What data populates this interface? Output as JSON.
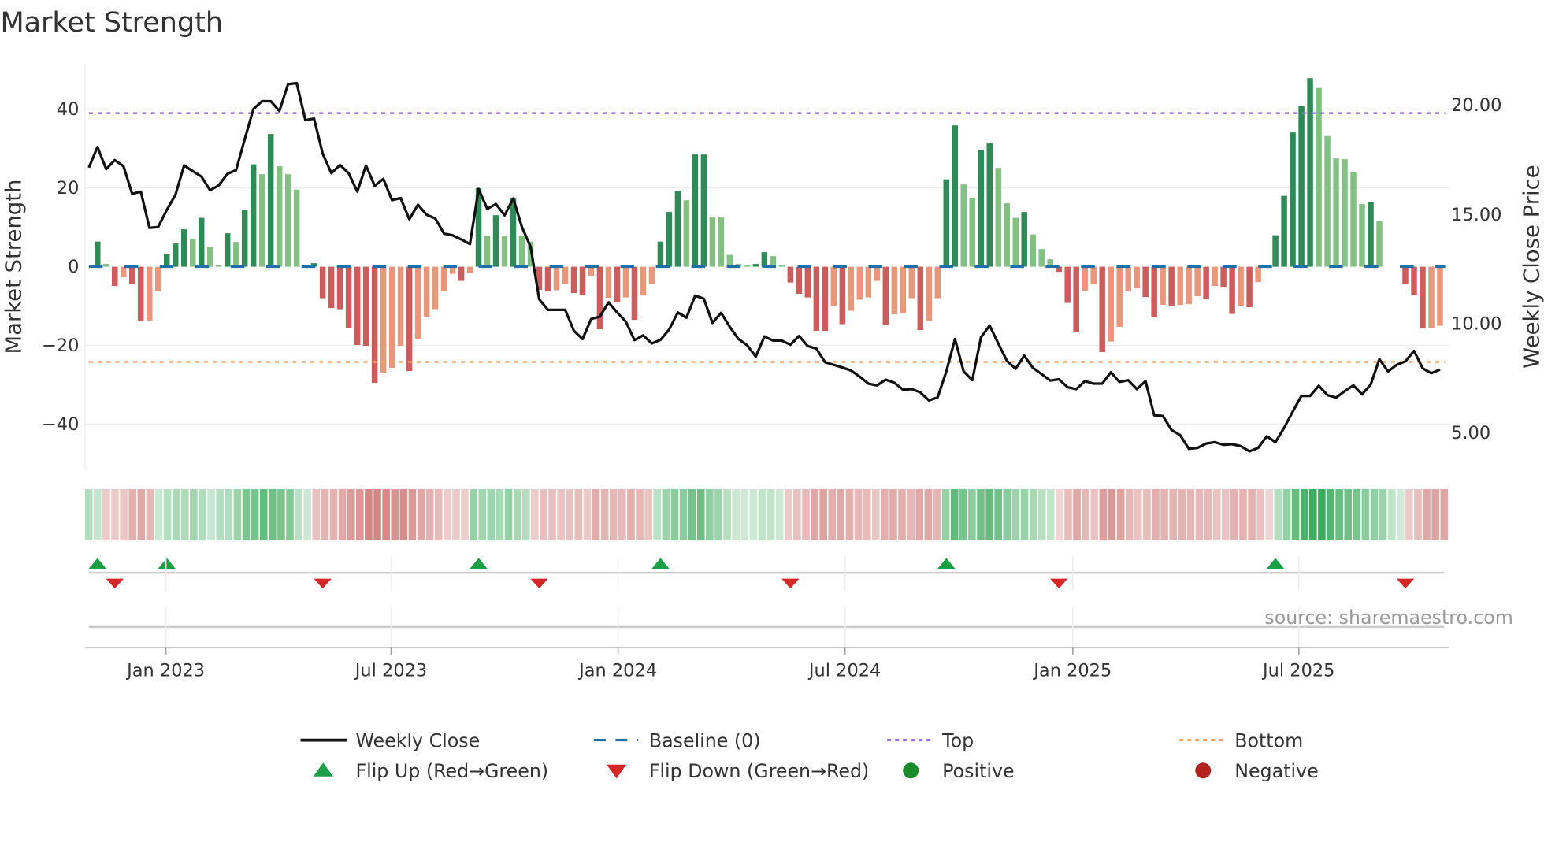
{
  "title": "Market Strength",
  "source": "source: sharemaestro.com",
  "chart_data": {
    "type": "bar+line",
    "title": "Market Strength",
    "ylabel": "Market Strength",
    "y2label": "Weekly Close Price",
    "ylim": [
      -51.75,
      51.5
    ],
    "y2lim": [
      3.4,
      21.9
    ],
    "grid": true,
    "legend_placement": "bottom-center",
    "yticks": [
      {
        "value": 40,
        "label": "40"
      },
      {
        "value": 20,
        "label": "20"
      },
      {
        "value": 0,
        "label": "0"
      },
      {
        "value": -20,
        "label": "−20"
      },
      {
        "value": -40,
        "label": "−40"
      }
    ],
    "y2ticks": [
      {
        "value": 20,
        "label": "20.00"
      },
      {
        "value": 15,
        "label": "15.00"
      },
      {
        "value": 10,
        "label": "10.00"
      },
      {
        "value": 5,
        "label": "5.00"
      }
    ],
    "xticks": [
      {
        "week": 7.9,
        "label": "Jan 2023"
      },
      {
        "week": 33.9,
        "label": "Jul 2023"
      },
      {
        "week": 60.1,
        "label": "Jan 2024"
      },
      {
        "week": 86.3,
        "label": "Jul 2024"
      },
      {
        "week": 112.6,
        "label": "Jan 2025"
      },
      {
        "week": 138.7,
        "label": "Jul 2025"
      }
    ],
    "top_level": 39,
    "bottom_level": -24.2,
    "baseline": 0,
    "strength": [
      6.4,
      0.7,
      -4.9,
      -2.7,
      -4.3,
      -13.8,
      -13.7,
      -6.3,
      3.2,
      5.9,
      9.5,
      7.0,
      12.4,
      5.0,
      0.4,
      8.5,
      6.3,
      14.4,
      26,
      23.5,
      33.7,
      25.5,
      23.5,
      19.6,
      0,
      0.9,
      -8,
      -10.5,
      -10.8,
      -15.5,
      -19.9,
      -20.1,
      -29.5,
      -26.9,
      -25.7,
      -20.1,
      -26.5,
      -18.3,
      -12.7,
      -10.8,
      -6.3,
      -1.8,
      -3.6,
      -1.6,
      19.9,
      7.9,
      13.1,
      7.9,
      17.3,
      7.9,
      6.4,
      -5.9,
      -6.3,
      -6.0,
      -4.3,
      -6.7,
      -7.3,
      -2.3,
      -15.9,
      -7.9,
      -9.0,
      -7.8,
      -13.5,
      -7.3,
      -4.3,
      6.4,
      13.9,
      19.2,
      16.9,
      28.5,
      28.5,
      12.7,
      12.5,
      3.0,
      0.7,
      0.3,
      0.7,
      3.7,
      2.7,
      0.5,
      -4.0,
      -6.9,
      -7.8,
      -16.3,
      -16.3,
      -10.0,
      -14.6,
      -11.2,
      -8.4,
      -7.8,
      -3.6,
      -14.8,
      -12.1,
      -11.8,
      -8.0,
      -16.1,
      -13.7,
      -8.0,
      22.2,
      35.9,
      20.9,
      17.5,
      29.7,
      31.4,
      25.1,
      16.1,
      12.4,
      13.9,
      8.2,
      4.5,
      1.9,
      -1.3,
      -9.2,
      -16.7,
      -6.1,
      -4.5,
      -21.7,
      -19.0,
      -15.3,
      -6.3,
      -5.5,
      -7.7,
      -12.9,
      -9.7,
      -10.0,
      -9.7,
      -9.5,
      -7.5,
      -8.3,
      -4.9,
      -5.3,
      -12.0,
      -9.9,
      -10.3,
      -3.9,
      -0.1,
      8.0,
      18.0,
      34.1,
      40.9,
      47.9,
      45.4,
      33.2,
      27.5,
      27.3,
      24.0,
      15.9,
      16.4,
      11.6,
      0,
      0,
      -4.3,
      -7.1,
      -15.7,
      -15.5,
      -15.0
    ],
    "weekly_close": [
      17.15,
      18.09,
      17.08,
      17.49,
      17.21,
      15.95,
      16.05,
      14.39,
      14.43,
      15.21,
      15.9,
      17.25,
      16.98,
      16.74,
      16.11,
      16.34,
      16.86,
      17.03,
      18.45,
      19.83,
      20.19,
      20.19,
      19.74,
      20.97,
      21.02,
      19.32,
      19.39,
      17.79,
      16.89,
      17.27,
      16.89,
      16.05,
      17.25,
      16.31,
      16.63,
      15.66,
      15.75,
      14.79,
      15.45,
      14.99,
      14.82,
      14.13,
      14.05,
      13.86,
      13.65,
      16.17,
      15.26,
      15.48,
      14.97,
      15.74,
      14.43,
      13.53,
      11.12,
      10.64,
      10.64,
      10.64,
      9.68,
      9.3,
      10.22,
      10.33,
      10.98,
      10.52,
      10.1,
      9.25,
      9.47,
      9.1,
      9.26,
      9.74,
      10.52,
      10.28,
      11.29,
      11.15,
      10.04,
      10.5,
      9.86,
      9.3,
      9.02,
      8.5,
      9.42,
      9.23,
      9.23,
      9.04,
      9.44,
      8.98,
      8.86,
      8.24,
      8.12,
      8.0,
      7.86,
      7.58,
      7.26,
      7.18,
      7.44,
      7.3,
      6.98,
      7.01,
      6.86,
      6.49,
      6.63,
      7.82,
      9.3,
      7.82,
      7.42,
      9.38,
      9.92,
      9.1,
      8.3,
      7.94,
      8.54,
      7.98,
      7.7,
      7.4,
      7.46,
      7.1,
      7.01,
      7.38,
      7.26,
      7.26,
      7.78,
      7.34,
      7.42,
      7.01,
      7.38,
      5.81,
      5.78,
      5.14,
      4.9,
      4.28,
      4.32,
      4.52,
      4.58,
      4.46,
      4.49,
      4.4,
      4.16,
      4.32,
      4.85,
      4.58,
      5.24,
      5.98,
      6.7,
      6.7,
      7.16,
      6.74,
      6.62,
      6.92,
      7.18,
      6.77,
      7.22,
      8.38,
      7.82,
      8.12,
      8.28,
      8.76,
      7.96,
      7.74,
      7.9
    ],
    "flip_up_weeks": [
      0,
      8,
      44,
      65,
      98,
      136
    ],
    "flip_down_weeks": [
      2,
      26,
      51,
      80,
      111,
      151
    ],
    "colors": {
      "pos_strong": "#2e8b57",
      "pos_weak": "#82c182",
      "neg_strong": "#cd5c5c",
      "neg_weak": "#e9967a",
      "baseline": "#1f6fa8",
      "top": "#9b6fdc",
      "bottom": "#f4a460",
      "close": "#111111",
      "flip_up": "#1a9e46",
      "flip_down": "#d62728",
      "positive": "#1a8a2a",
      "negative": "#b22222"
    },
    "legend": [
      {
        "label": "Weekly Close",
        "icon": "solid-line"
      },
      {
        "label": "Baseline (0)",
        "icon": "dashed-line"
      },
      {
        "label": "Top",
        "icon": "dotted-line"
      },
      {
        "label": "Bottom",
        "icon": "dotted-line"
      },
      {
        "label": "Flip Up (Red→Green)",
        "icon": "triangle-up"
      },
      {
        "label": "Flip Down (Green→Red)",
        "icon": "triangle-down"
      },
      {
        "label": "Positive",
        "icon": "circle"
      },
      {
        "label": "Negative",
        "icon": "circle"
      }
    ]
  }
}
